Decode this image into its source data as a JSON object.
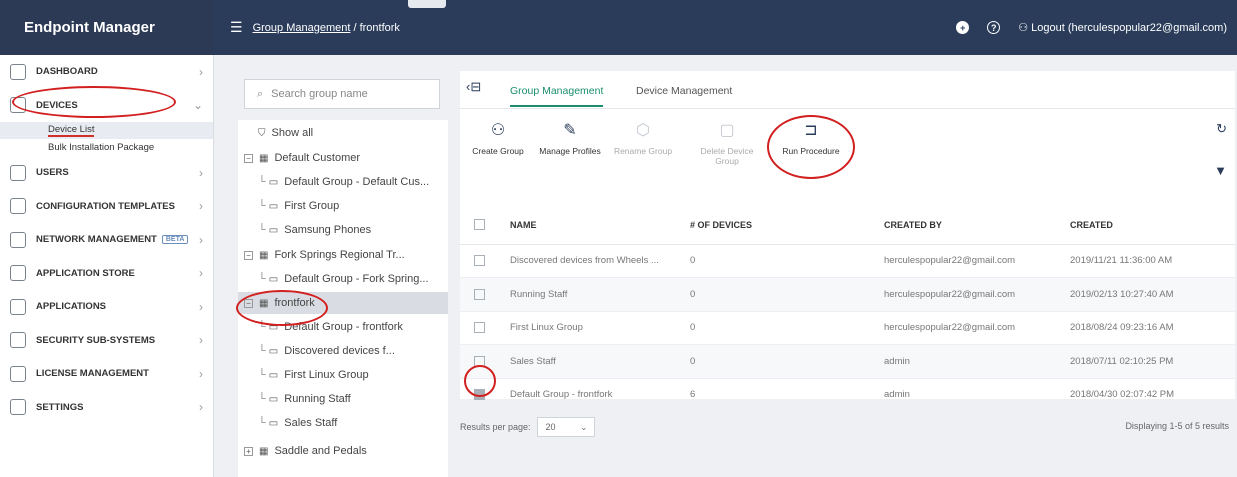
{
  "app": {
    "title": "Endpoint Manager"
  },
  "header": {
    "breadcrumb_parent": "Group Management",
    "breadcrumb_sep": " / ",
    "breadcrumb_current": "frontfork",
    "help_icon_text": "?",
    "add_icon_text": "+",
    "logout_label": "Logout (herculespopular22@gmail.com)"
  },
  "sidebar": {
    "items": [
      {
        "label": "Dashboard"
      },
      {
        "label": "Devices"
      },
      {
        "label": "Users"
      },
      {
        "label": "Configuration Templates"
      },
      {
        "label": "Network Management",
        "badge": "BETA"
      },
      {
        "label": "Application Store"
      },
      {
        "label": "Applications"
      },
      {
        "label": "Security Sub-Systems"
      },
      {
        "label": "License Management"
      },
      {
        "label": "Settings"
      }
    ],
    "device_sub": [
      {
        "label": "Device List"
      },
      {
        "label": "Bulk Installation Package"
      }
    ]
  },
  "tree": {
    "search_placeholder": "Search group name",
    "show_all": "Show all",
    "nodes": [
      {
        "label": "Default Customer"
      },
      {
        "label": "Default Group - Default Cus..."
      },
      {
        "label": "First Group"
      },
      {
        "label": "Samsung Phones"
      },
      {
        "label": "Fork Springs Regional Tr..."
      },
      {
        "label": "Default Group - Fork Spring..."
      },
      {
        "label": "frontfork"
      },
      {
        "label": "Default Group - frontfork"
      },
      {
        "label": "Discovered devices f..."
      },
      {
        "label": "First Linux Group"
      },
      {
        "label": "Running Staff"
      },
      {
        "label": "Sales Staff"
      },
      {
        "label": "Saddle and Pedals"
      }
    ]
  },
  "tabs": [
    {
      "label": "Group Management"
    },
    {
      "label": "Device Management"
    }
  ],
  "toolbar": {
    "create_group": "Create Group",
    "manage_profiles": "Manage Profiles",
    "rename_group": "Rename Group",
    "delete_device_group": "Delete Device Group",
    "run_procedure": "Run Procedure"
  },
  "table": {
    "columns": [
      "NAME",
      "# OF DEVICES",
      "CREATED BY",
      "CREATED"
    ],
    "rows": [
      {
        "name": "Discovered devices from Wheels ...",
        "devices": "0",
        "created_by": "herculespopular22@gmail.com",
        "created": "2019/11/21 11:36:00 AM"
      },
      {
        "name": "Running Staff",
        "devices": "0",
        "created_by": "herculespopular22@gmail.com",
        "created": "2019/02/13 10:27:40 AM"
      },
      {
        "name": "First Linux Group",
        "devices": "0",
        "created_by": "herculespopular22@gmail.com",
        "created": "2018/08/24 09:23:16 AM"
      },
      {
        "name": "Sales Staff",
        "devices": "0",
        "created_by": "admin",
        "created": "2018/07/11 02:10:25 PM"
      },
      {
        "name": "Default Group - frontfork",
        "devices": "6",
        "created_by": "admin",
        "created": "2018/04/30 02:07:42 PM"
      }
    ]
  },
  "footer": {
    "results_per_page_label": "Results per page:",
    "results_per_page_value": "20",
    "displaying": "Displaying 1-5 of 5 results"
  },
  "colors": {
    "brand_bg": "#2c3a55",
    "accent_green": "#1a8e6e",
    "link_blue": "#3a6fb0",
    "annotation_red": "#d21f1f"
  }
}
